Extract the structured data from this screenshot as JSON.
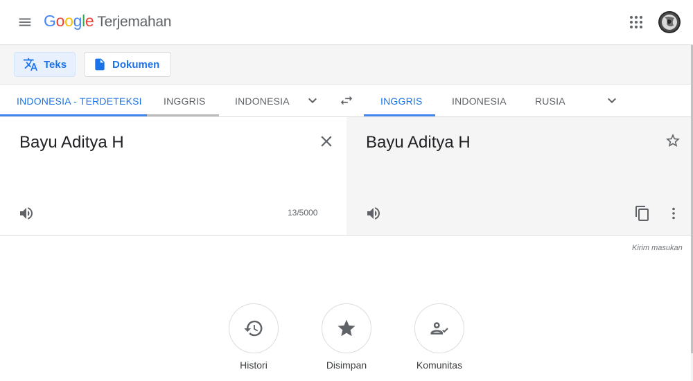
{
  "header": {
    "logo_letters": [
      "G",
      "o",
      "o",
      "g",
      "l",
      "e"
    ],
    "product_name": "Terjemahan"
  },
  "modes": {
    "text_label": "Teks",
    "doc_label": "Dokumen"
  },
  "source_langs": {
    "items": [
      "INDONESIA - TERDETEKSI",
      "INGGRIS",
      "INDONESIA"
    ],
    "active_index": 0
  },
  "target_langs": {
    "items": [
      "INGGRIS",
      "INDONESIA",
      "RUSIA"
    ],
    "active_index": 0
  },
  "source": {
    "text": "Bayu Aditya H",
    "char_count": "13/5000"
  },
  "target": {
    "text": "Bayu Aditya H"
  },
  "feedback_label": "Kirim masukan",
  "actions": [
    {
      "label": "Histori",
      "icon": "history-icon"
    },
    {
      "label": "Disimpan",
      "icon": "star-icon"
    },
    {
      "label": "Komunitas",
      "icon": "community-icon"
    }
  ],
  "colors": {
    "accent": "#1a73e8",
    "tab_underline_active": "#4285f4",
    "tab_underline_hover": "#bdbdbd"
  }
}
